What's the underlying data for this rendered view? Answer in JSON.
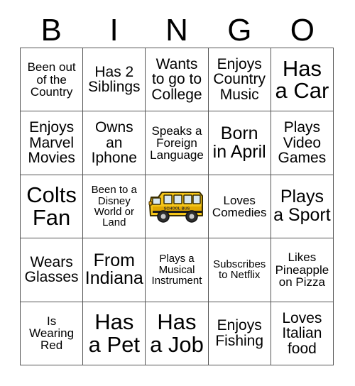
{
  "header": {
    "letters": [
      "B",
      "I",
      "N",
      "G",
      "O"
    ]
  },
  "card": {
    "title": "BINGO",
    "columns": 5,
    "rows": 5,
    "border_color": "#555555",
    "text_color": "#000000",
    "background_color": "#ffffff"
  },
  "cells": [
    {
      "text": "Been out\nof the\nCountry",
      "size": "fs-sm",
      "type": "text"
    },
    {
      "text": "Has 2\nSiblings",
      "size": "fs-md",
      "type": "text"
    },
    {
      "text": "Wants\nto go to\nCollege",
      "size": "fs-md",
      "type": "text"
    },
    {
      "text": "Enjoys\nCountry\nMusic",
      "size": "fs-md",
      "type": "text"
    },
    {
      "text": "Has\na Car",
      "size": "fs-xl",
      "type": "text"
    },
    {
      "text": "Enjoys\nMarvel\nMovies",
      "size": "fs-md",
      "type": "text"
    },
    {
      "text": "Owns\nan\nIphone",
      "size": "fs-md",
      "type": "text"
    },
    {
      "text": "Speaks a\nForeign\nLanguage",
      "size": "fs-sm",
      "type": "text"
    },
    {
      "text": "Born\nin April",
      "size": "fs-lg",
      "type": "text"
    },
    {
      "text": "Plays\nVideo\nGames",
      "size": "fs-md",
      "type": "text"
    },
    {
      "text": "Colts\nFan",
      "size": "fs-xl",
      "type": "text"
    },
    {
      "text": "Been to a\nDisney\nWorld or\nLand",
      "size": "fs-xs",
      "type": "text"
    },
    {
      "text": "",
      "size": "fs-md",
      "type": "image",
      "image": "school-bus",
      "image_label": "SCHOOL BUS"
    },
    {
      "text": "Loves\nComedies",
      "size": "fs-sm",
      "type": "text"
    },
    {
      "text": "Plays\na Sport",
      "size": "fs-lg",
      "type": "text"
    },
    {
      "text": "Wears\nGlasses",
      "size": "fs-md",
      "type": "text"
    },
    {
      "text": "From\nIndiana",
      "size": "fs-lg",
      "type": "text"
    },
    {
      "text": "Plays a\nMusical\nInstrument",
      "size": "fs-xs",
      "type": "text"
    },
    {
      "text": "Subscribes\nto Netflix",
      "size": "fs-xs",
      "type": "text"
    },
    {
      "text": "Likes\nPineapple\non Pizza",
      "size": "fs-sm",
      "type": "text"
    },
    {
      "text": "Is\nWearing\nRed",
      "size": "fs-sm",
      "type": "text"
    },
    {
      "text": "Has\na Pet",
      "size": "fs-xl",
      "type": "text"
    },
    {
      "text": "Has\na Job",
      "size": "fs-xl",
      "type": "text"
    },
    {
      "text": "Enjoys\nFishing",
      "size": "fs-md",
      "type": "text"
    },
    {
      "text": "Loves\nItalian\nfood",
      "size": "fs-md",
      "type": "text"
    }
  ],
  "free_space": {
    "icon": "school-bus-icon",
    "sign_text": "SCHOOL BUS",
    "body_color": "#f5c518",
    "body_shade": "#e0a800",
    "window_color": "#d8e8f0",
    "wheel_color": "#2e2e2e",
    "outline_color": "#3a2e00"
  }
}
